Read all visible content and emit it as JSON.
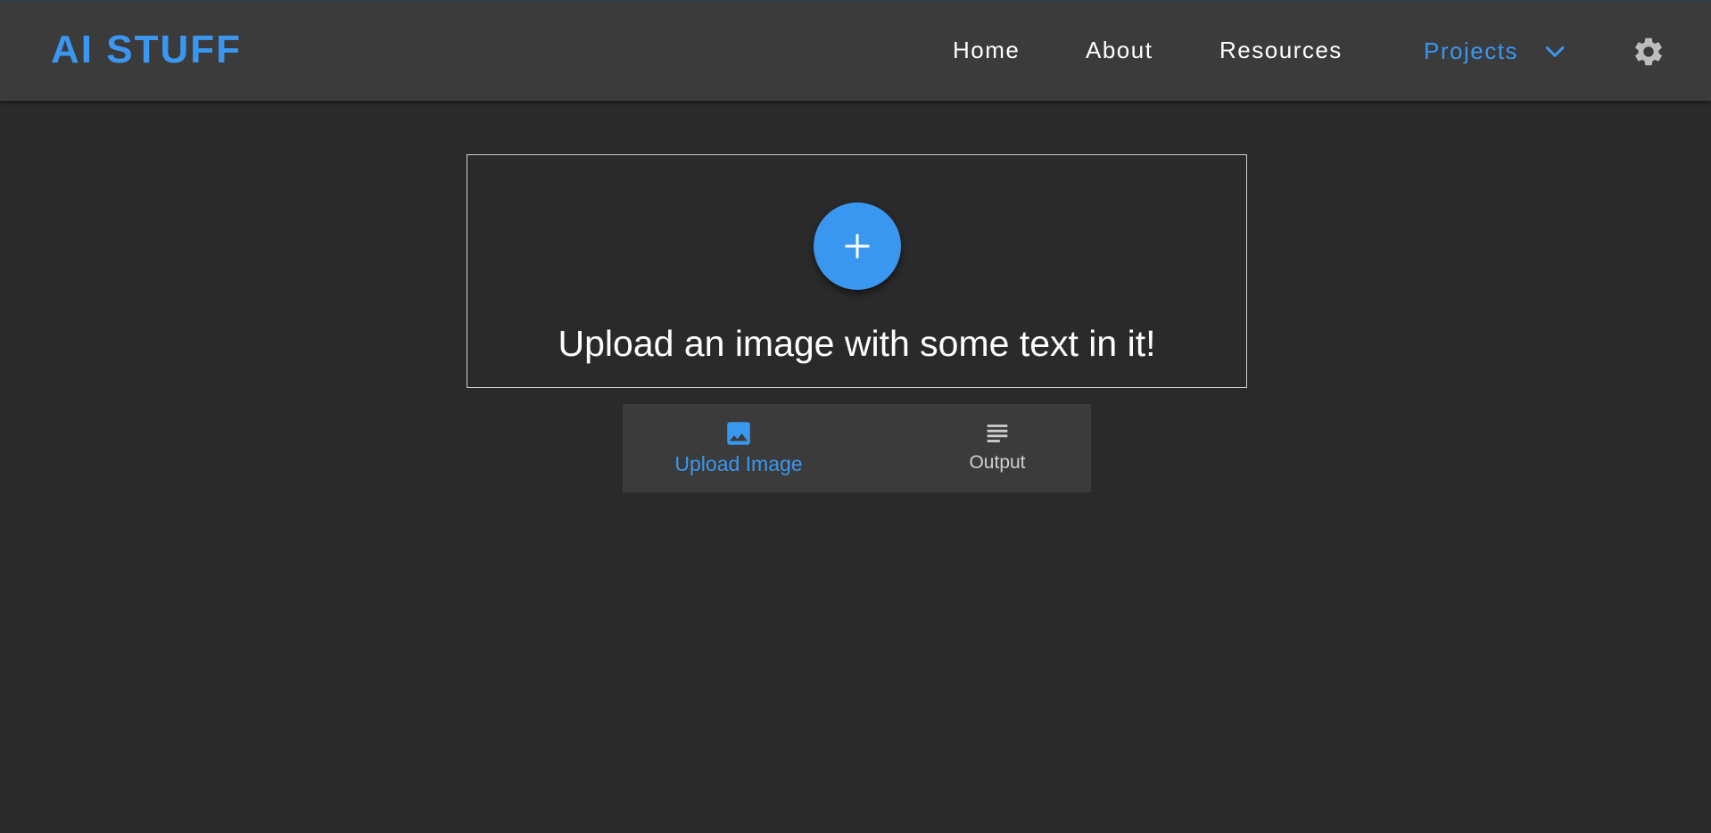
{
  "app": {
    "brand": "AI STUFF",
    "accent_color": "#3a97f0"
  },
  "nav": {
    "items": [
      {
        "label": "Home"
      },
      {
        "label": "About"
      },
      {
        "label": "Resources"
      }
    ],
    "projects": {
      "label": "Projects",
      "icon": "chevron-down-icon",
      "active": true
    },
    "settings_icon": "gear-icon"
  },
  "upload": {
    "button_icon": "plus-icon",
    "prompt": "Upload an image with some text in it!"
  },
  "tabs": [
    {
      "label": "Upload Image",
      "icon": "image-icon",
      "selected": true
    },
    {
      "label": "Output",
      "icon": "subject-lines-icon",
      "selected": false
    }
  ]
}
